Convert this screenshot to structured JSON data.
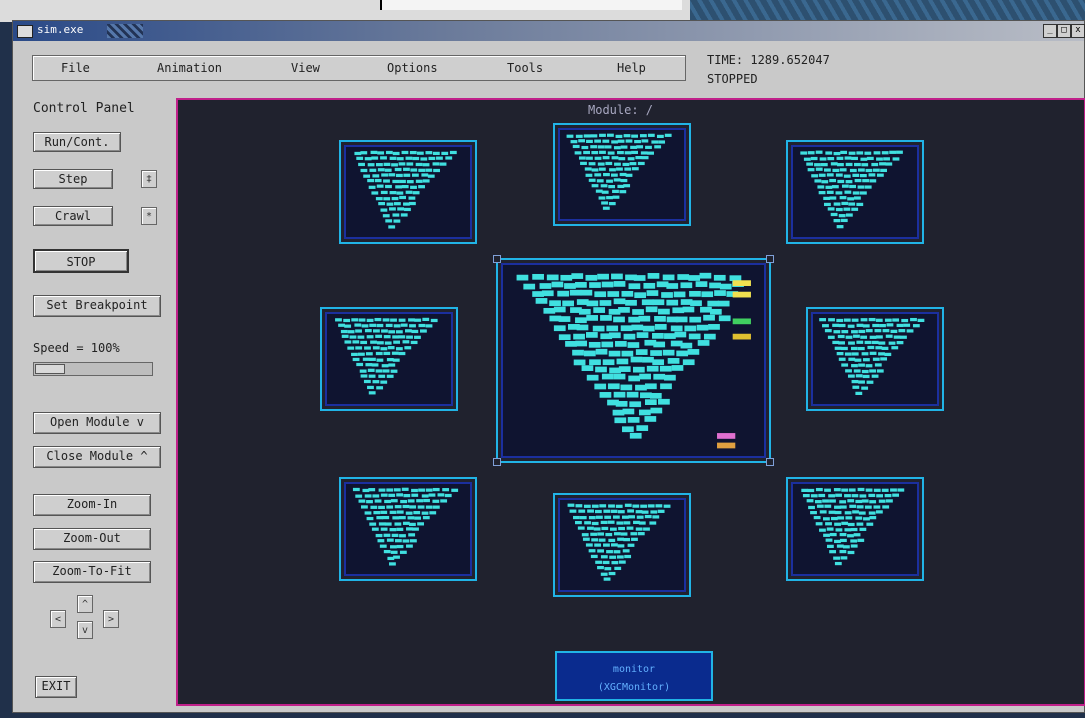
{
  "window": {
    "title": "sim.exe",
    "controls": {
      "minimize": "_",
      "maximize": "□",
      "close": "x"
    }
  },
  "menu": {
    "items": [
      "File",
      "Animation",
      "View",
      "Options",
      "Tools",
      "Help"
    ]
  },
  "status": {
    "time": "TIME: 1289.652047",
    "state": "STOPPED"
  },
  "control_panel": {
    "title": "Control Panel",
    "run": "Run/Cont.",
    "step": "Step",
    "step_opt": "‡",
    "crawl": "Crawl",
    "crawl_opt": "*",
    "stop": "STOP",
    "breakpoint": "Set Breakpoint",
    "speed_label": "Speed = 100%",
    "speed_fraction": 0.25,
    "open_module": "Open Module  v",
    "close_module": "Close Module ^",
    "zoom_in": "Zoom-In",
    "zoom_out": "Zoom-Out",
    "zoom_fit": "Zoom-To-Fit",
    "pan_up": "^",
    "pan_left": "<",
    "pan_down": "v",
    "pan_right": ">",
    "exit": "EXIT"
  },
  "canvas": {
    "module_path": "Module:  /",
    "monitor_name": "monitor",
    "monitor_type": "(XGCMonitor)"
  },
  "colors": {
    "accent_frame": "#c0208a",
    "module_border": "#21b4e6",
    "block": "#40e0e0"
  }
}
